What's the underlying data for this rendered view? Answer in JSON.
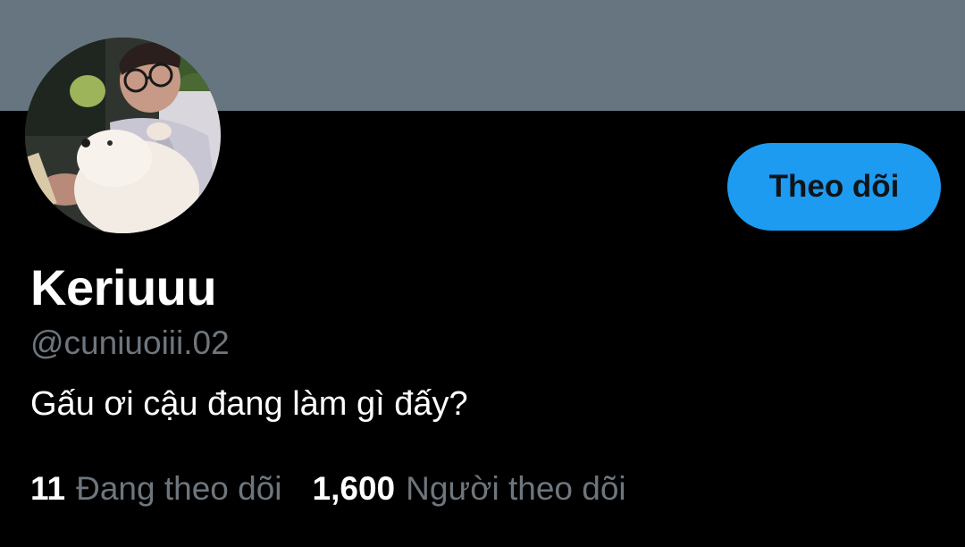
{
  "profile": {
    "banner_color": "#66757f",
    "avatar_alt": "profile-photo",
    "display_name": "Keriuuu",
    "handle": "@cuniuoiii.02",
    "bio": "Gấu ơi cậu đang làm gì đấy?",
    "follow_button_label": "Theo dõi",
    "follow_button_color": "#1d9bf0"
  },
  "stats": {
    "following_count": "11",
    "following_label": "Đang theo dõi",
    "followers_count": "1,600",
    "followers_label": "Người theo dõi"
  }
}
